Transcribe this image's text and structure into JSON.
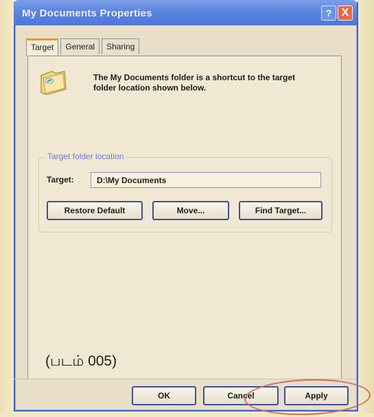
{
  "window": {
    "title": "My Documents Properties",
    "help_label": "?",
    "close_label": "X"
  },
  "tabs": [
    {
      "label": "Target"
    },
    {
      "label": "General"
    },
    {
      "label": "Sharing"
    }
  ],
  "content": {
    "description": "The My Documents folder is a shortcut to the target folder location shown below.",
    "group_title": "Target folder location",
    "target_label": "Target:",
    "target_value": "D:\\My Documents",
    "restore_label": "Restore Default",
    "move_label": "Move...",
    "find_label": "Find Target...",
    "watermark": "(படம் 005)"
  },
  "footer": {
    "ok_label": "OK",
    "cancel_label": "Cancel",
    "apply_label": "Apply"
  },
  "colors": {
    "titlebar": "#5d85df",
    "accent_tab": "#e39b34",
    "annotation": "#d46b57"
  },
  "icons": [
    "folder-shortcut-icon",
    "help-icon",
    "close-icon"
  ]
}
